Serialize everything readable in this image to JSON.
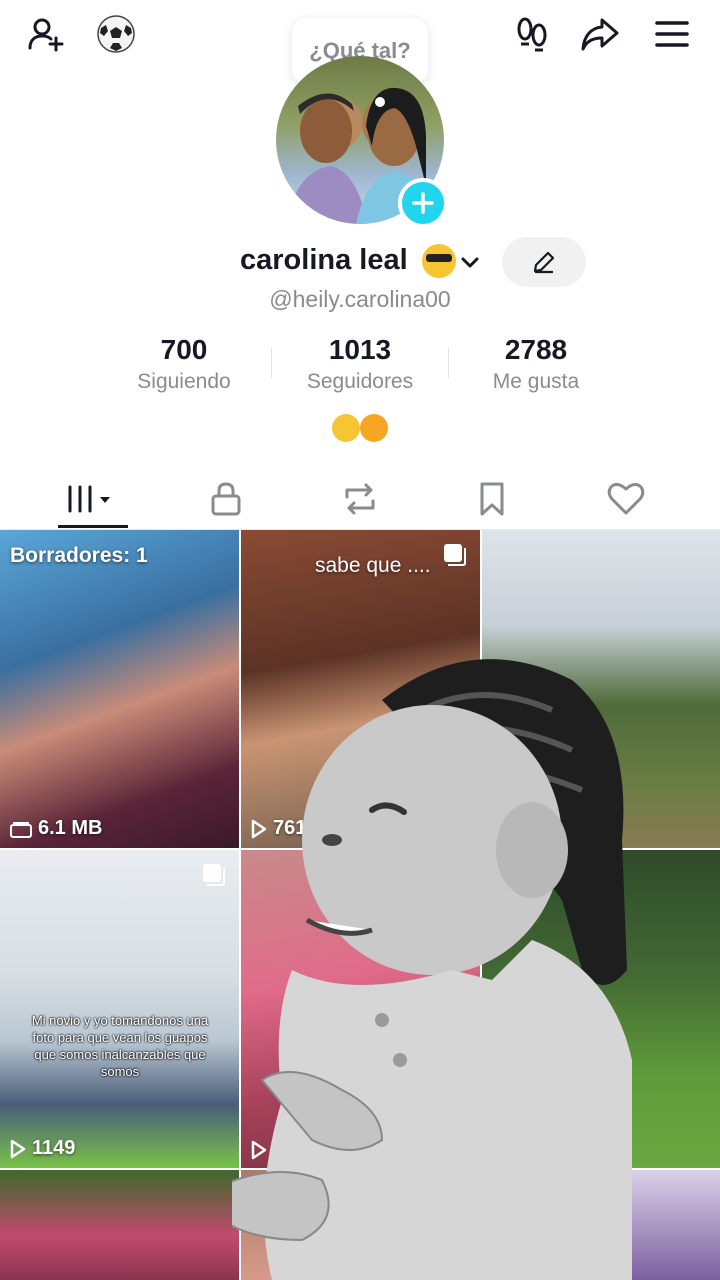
{
  "topbar": {
    "add_friend_icon": "person-plus-icon",
    "soccer_icon": "soccer-ball-icon",
    "footprints_icon": "footprints-icon",
    "share_icon": "share-arrow-icon",
    "menu_icon": "hamburger-menu-icon"
  },
  "note_bubble": {
    "text": "¿Qué tal?"
  },
  "profile": {
    "display_name": "carolina leal",
    "name_emoji": "sunglasses-emoji",
    "handle": "@heily.carolina00",
    "bio_emojis": [
      "pleading-face-emoji",
      "smiling-hearts-emoji"
    ]
  },
  "stats": [
    {
      "value": "700",
      "label": "Siguiendo"
    },
    {
      "value": "1013",
      "label": "Seguidores"
    },
    {
      "value": "2788",
      "label": "Me gusta"
    }
  ],
  "tabs": [
    {
      "icon": "grid-icon"
    },
    {
      "icon": "lock-icon"
    },
    {
      "icon": "repost-icon"
    },
    {
      "icon": "bookmark-icon"
    },
    {
      "icon": "heart-icon"
    }
  ],
  "grid": {
    "drafts_label": "Borradores: 1",
    "drafts_size": "6.1 MB",
    "post2_text": "sabe que ....",
    "post2_views": "761",
    "post4_caption": "Mi novio y yo tomandonos una foto para que vean los guapos  que somos inalcanzables que somos",
    "post4_views": "1149"
  },
  "colors": {
    "accent": "#20d5ec",
    "text_primary": "#161823",
    "text_secondary": "#8a8b91"
  }
}
